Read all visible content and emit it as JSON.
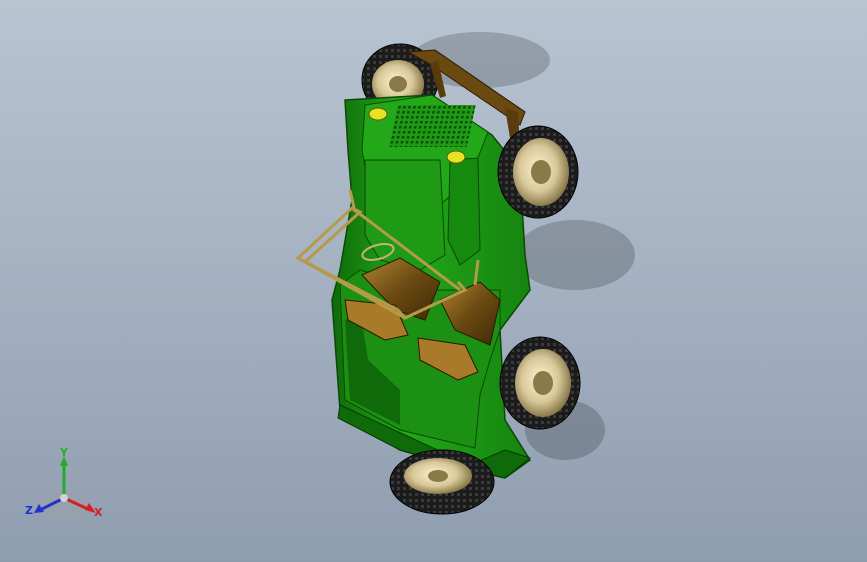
{
  "window": {
    "title": "",
    "background_top": "#b9c4d1",
    "background_bottom": "#8f9db0"
  },
  "model": {
    "name": "",
    "colors": {
      "body": "#1f9a14",
      "body_dark": "#0f6a0a",
      "body_light": "#3cc22a",
      "seat": "#6b4a12",
      "seat_light": "#a97a2a",
      "frame": "#b59a4a",
      "tire": "#1b1b1b",
      "rim": "#d8c89a",
      "lamp": "#e9e224"
    }
  },
  "triad": {
    "x_label": "X",
    "y_label": "Y",
    "z_label": "Z",
    "colors": {
      "x": "#d42020",
      "y": "#22b022",
      "z": "#2233cc"
    }
  }
}
